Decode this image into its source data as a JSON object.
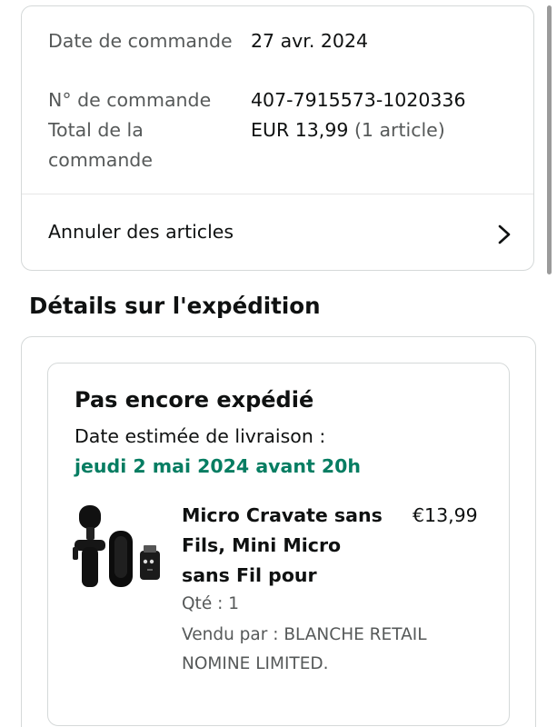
{
  "order_summary": {
    "date_label": "Date de commande",
    "date_value": "27 avr. 2024",
    "number_label": "N° de commande",
    "number_value": "407-7915573-1020336",
    "total_label": "Total de la commande",
    "total_amount": "EUR 13,99",
    "total_items": "(1 article)",
    "cancel_label": "Annuler des articles",
    "cancel_icon": "chevron-right-icon"
  },
  "shipping": {
    "title": "Détails sur l'expédition",
    "status": "Pas encore expédié",
    "eta_label": "Date estimée de livraison :",
    "eta_date": "jeudi 2 mai 2024 avant 20h",
    "eta_color": "#067d62"
  },
  "item": {
    "title": "Micro Cravate sans Fils, Mini Micro sans Fil pour",
    "price": "€13,99",
    "qty": "Qté : 1",
    "seller": "Vendu par : BLANCHE RETAIL NOMINE LIMITED."
  }
}
